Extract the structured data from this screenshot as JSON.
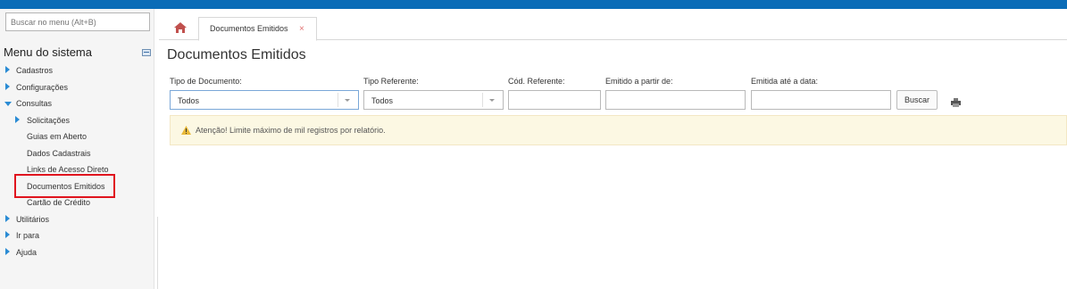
{
  "sidebar": {
    "search_placeholder": "Buscar no menu (Alt+B)",
    "title": "Menu do sistema",
    "items": [
      {
        "label": "Cadastros"
      },
      {
        "label": "Configurações"
      },
      {
        "label": "Consultas"
      },
      {
        "label": "Solicitações"
      },
      {
        "label": "Guias em Aberto"
      },
      {
        "label": "Dados Cadastrais"
      },
      {
        "label": "Links de Acesso Direto"
      },
      {
        "label": "Documentos Emitidos"
      },
      {
        "label": "Cartão de Crédito"
      },
      {
        "label": "Utilitários"
      },
      {
        "label": "Ir para"
      },
      {
        "label": "Ajuda"
      }
    ]
  },
  "tabs": {
    "home_icon": "home-icon",
    "active_label": "Documentos Emitidos",
    "close_glyph": "×"
  },
  "page": {
    "title": "Documentos Emitidos"
  },
  "filters": {
    "tipo_documento": {
      "label": "Tipo de Documento:",
      "value": "Todos"
    },
    "tipo_referente": {
      "label": "Tipo Referente:",
      "value": "Todos"
    },
    "cod_referente": {
      "label": "Cód. Referente:",
      "value": ""
    },
    "emitido_a_partir": {
      "label": "Emitido a partir de:",
      "value": ""
    },
    "emitida_ate": {
      "label": "Emitida até a data:",
      "value": ""
    },
    "search_button": "Buscar"
  },
  "alert": {
    "text": "Atenção! Limite máximo de mil registros por relatório."
  },
  "colors": {
    "topbar": "#0b6cb7",
    "highlight": "#e0141e",
    "alert_bg": "#fcf8e3"
  }
}
